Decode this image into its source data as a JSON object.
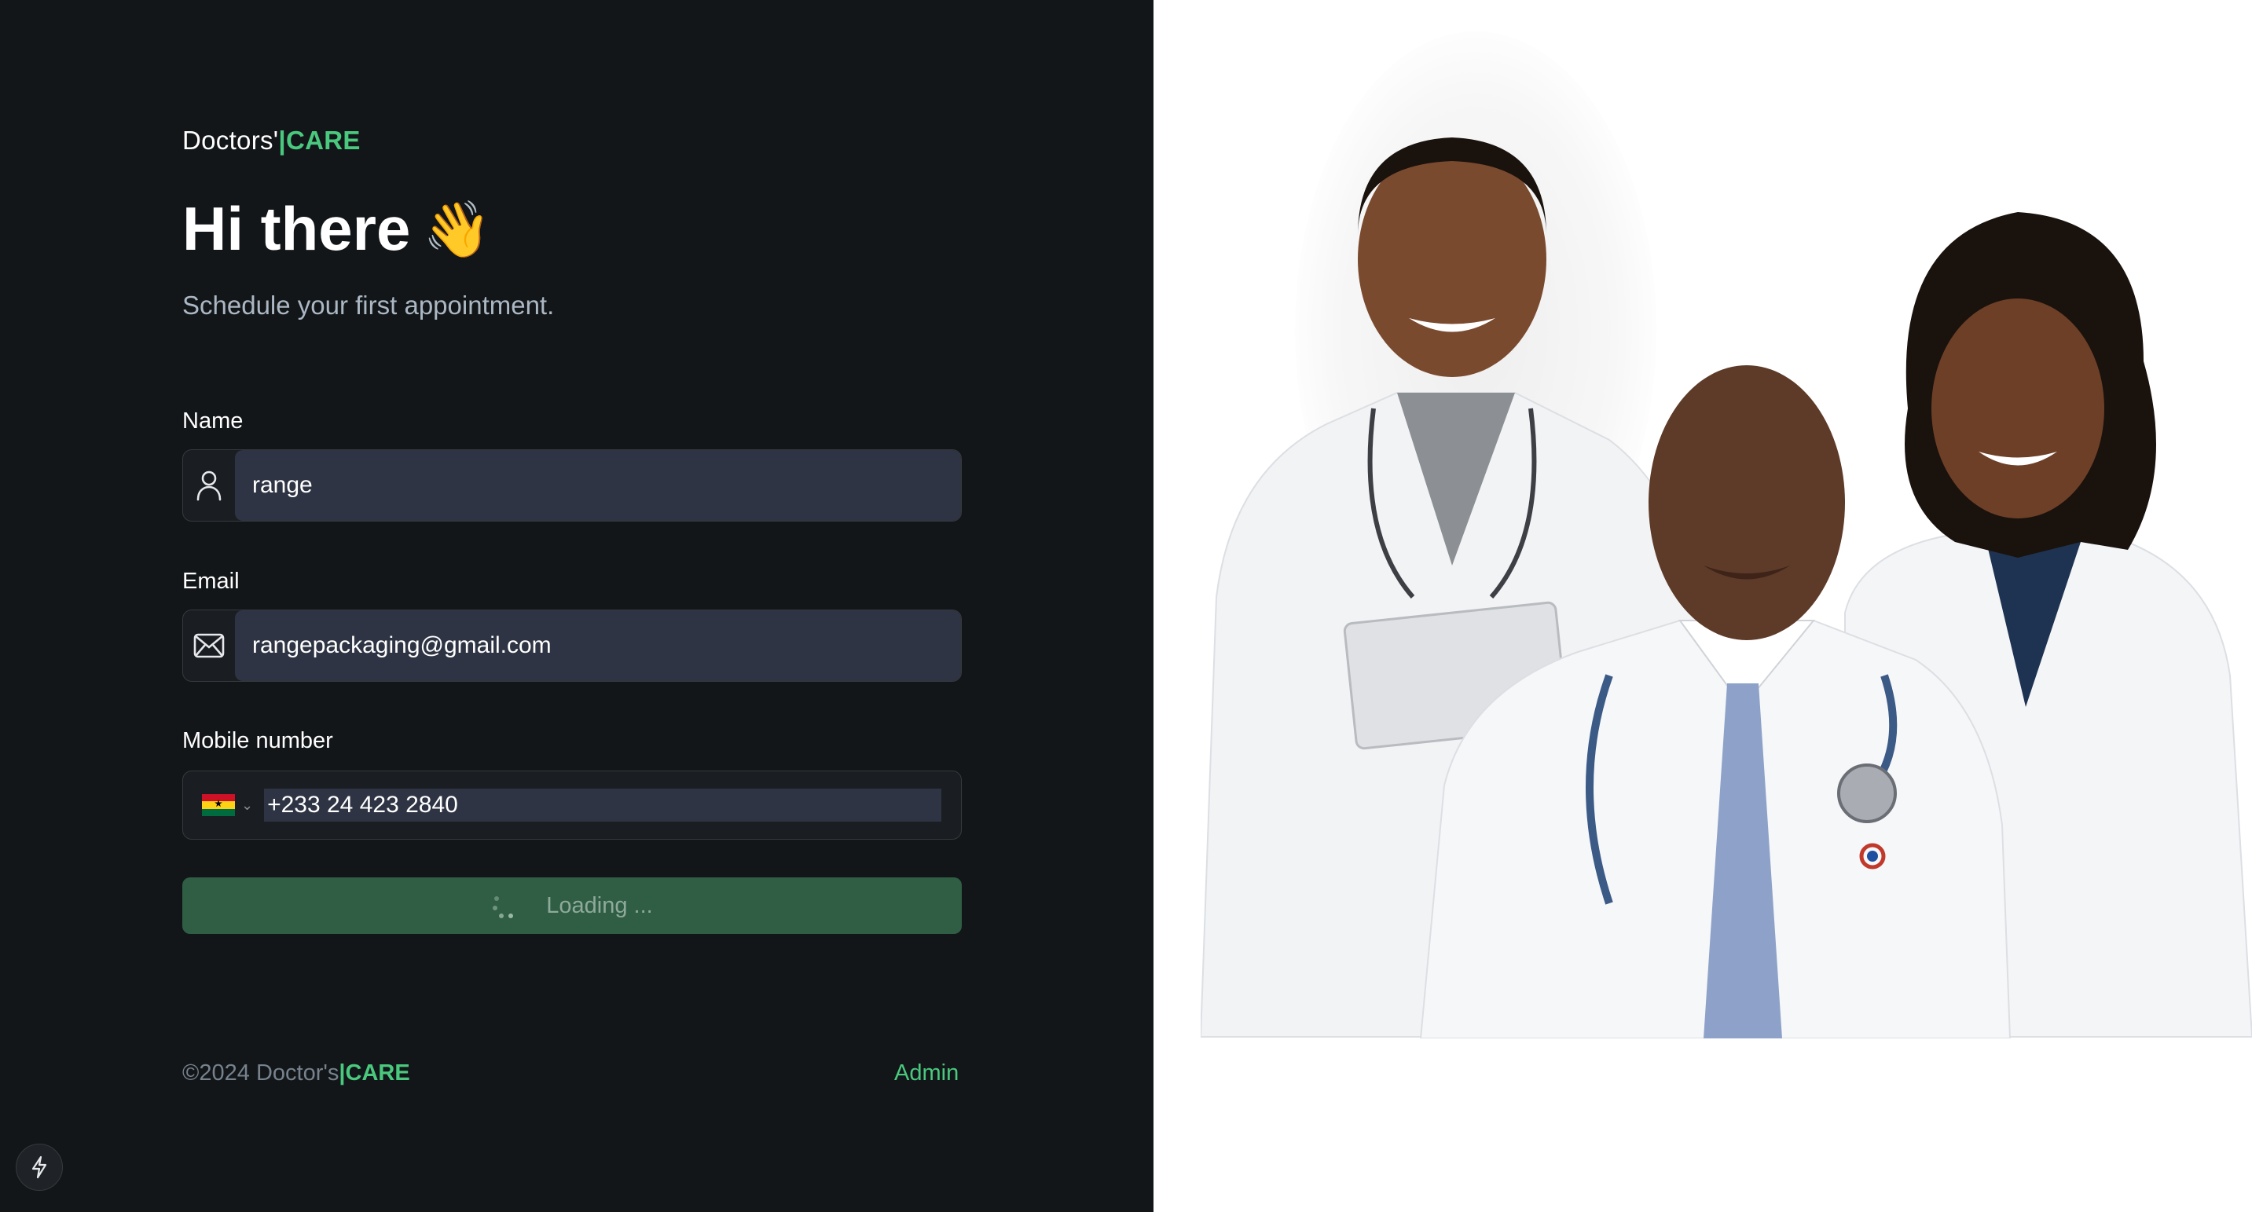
{
  "brand": {
    "name": "Doctors'",
    "bar": "|",
    "accent": "CARE"
  },
  "greeting": {
    "title": "Hi there",
    "emoji": "👋",
    "subtitle": "Schedule your first appointment."
  },
  "form": {
    "name": {
      "label": "Name",
      "value": "range",
      "icon": "user-icon"
    },
    "email": {
      "label": "Email",
      "value": "rangepackaging@gmail.com",
      "icon": "mail-icon"
    },
    "phone": {
      "label": "Mobile number",
      "value": "+233 24 423 2840",
      "country_flag": "ghana-flag-icon"
    },
    "submit": {
      "label": "Loading ..."
    }
  },
  "footer": {
    "copyright": "©2024 Doctor's",
    "bar": "|",
    "accent": "CARE",
    "admin_link": "Admin"
  },
  "colors": {
    "accent": "#4ac97e",
    "background": "#131619",
    "input": "#2e3443",
    "button": "#2f5e45"
  },
  "illustration": {
    "name": "doctors-photo"
  }
}
